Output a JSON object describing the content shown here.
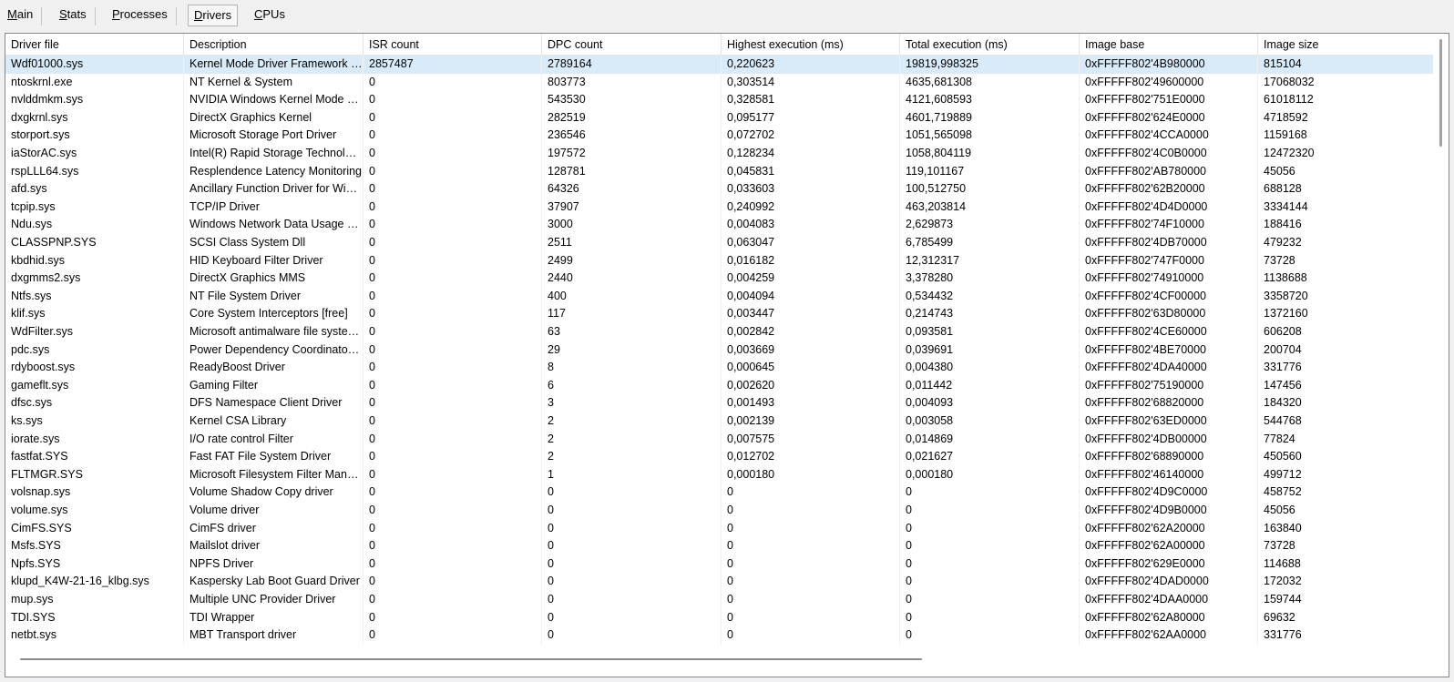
{
  "tabs": [
    {
      "label": "Main",
      "active": false
    },
    {
      "label": "Stats",
      "active": false
    },
    {
      "label": "Processes",
      "active": false
    },
    {
      "label": "Drivers",
      "active": true
    },
    {
      "label": "CPUs",
      "active": false
    }
  ],
  "columns": [
    "Driver file",
    "Description",
    "ISR count",
    "DPC count",
    "Highest execution (ms)",
    "Total execution (ms)",
    "Image base",
    "Image size"
  ],
  "rows": [
    [
      "Wdf01000.sys",
      "Kernel Mode Driver Framework Runtime",
      "2857487",
      "2789164",
      "0,220623",
      "19819,998325",
      "0xFFFFF802'4B980000",
      "815104"
    ],
    [
      "ntoskrnl.exe",
      "NT Kernel & System",
      "0",
      "803773",
      "0,303514",
      "4635,681308",
      "0xFFFFF802'49600000",
      "17068032"
    ],
    [
      "nvlddmkm.sys",
      "NVIDIA Windows Kernel Mode Driver",
      "0",
      "543530",
      "0,328581",
      "4121,608593",
      "0xFFFFF802'751E0000",
      "61018112"
    ],
    [
      "dxgkrnl.sys",
      "DirectX Graphics Kernel",
      "0",
      "282519",
      "0,095177",
      "4601,719889",
      "0xFFFFF802'624E0000",
      "4718592"
    ],
    [
      "storport.sys",
      "Microsoft Storage Port Driver",
      "0",
      "236546",
      "0,072702",
      "1051,565098",
      "0xFFFFF802'4CCA0000",
      "1159168"
    ],
    [
      "iaStorAC.sys",
      "Intel(R) Rapid Storage Technology driver",
      "0",
      "197572",
      "0,128234",
      "1058,804119",
      "0xFFFFF802'4C0B0000",
      "12472320"
    ],
    [
      "rspLLL64.sys",
      "Resplendence Latency Monitoring",
      "0",
      "128781",
      "0,045831",
      "119,101167",
      "0xFFFFF802'AB780000",
      "45056"
    ],
    [
      "afd.sys",
      "Ancillary Function Driver for WinSock",
      "0",
      "64326",
      "0,033603",
      "100,512750",
      "0xFFFFF802'62B20000",
      "688128"
    ],
    [
      "tcpip.sys",
      "TCP/IP Driver",
      "0",
      "37907",
      "0,240992",
      "463,203814",
      "0xFFFFF802'4D4D0000",
      "3334144"
    ],
    [
      "Ndu.sys",
      "Windows Network Data Usage Monitoring Driver",
      "0",
      "3000",
      "0,004083",
      "2,629873",
      "0xFFFFF802'74F10000",
      "188416"
    ],
    [
      "CLASSPNP.SYS",
      "SCSI Class System Dll",
      "0",
      "2511",
      "0,063047",
      "6,785499",
      "0xFFFFF802'4DB70000",
      "479232"
    ],
    [
      "kbdhid.sys",
      "HID Keyboard Filter Driver",
      "0",
      "2499",
      "0,016182",
      "12,312317",
      "0xFFFFF802'747F0000",
      "73728"
    ],
    [
      "dxgmms2.sys",
      "DirectX Graphics MMS",
      "0",
      "2440",
      "0,004259",
      "3,378280",
      "0xFFFFF802'74910000",
      "1138688"
    ],
    [
      "Ntfs.sys",
      "NT File System Driver",
      "0",
      "400",
      "0,004094",
      "0,534432",
      "0xFFFFF802'4CF00000",
      "3358720"
    ],
    [
      "klif.sys",
      "Core System Interceptors [free]",
      "0",
      "117",
      "0,003447",
      "0,214743",
      "0xFFFFF802'63D80000",
      "1372160"
    ],
    [
      "WdFilter.sys",
      "Microsoft antimalware file system filter driver",
      "0",
      "63",
      "0,002842",
      "0,093581",
      "0xFFFFF802'4CE60000",
      "606208"
    ],
    [
      "pdc.sys",
      "Power Dependency Coordinator Driver",
      "0",
      "29",
      "0,003669",
      "0,039691",
      "0xFFFFF802'4BE70000",
      "200704"
    ],
    [
      "rdyboost.sys",
      "ReadyBoost Driver",
      "0",
      "8",
      "0,000645",
      "0,004380",
      "0xFFFFF802'4DA40000",
      "331776"
    ],
    [
      "gameflt.sys",
      "Gaming Filter",
      "0",
      "6",
      "0,002620",
      "0,011442",
      "0xFFFFF802'75190000",
      "147456"
    ],
    [
      "dfsc.sys",
      "DFS Namespace Client Driver",
      "0",
      "3",
      "0,001493",
      "0,004093",
      "0xFFFFF802'68820000",
      "184320"
    ],
    [
      "ks.sys",
      "Kernel CSA Library",
      "0",
      "2",
      "0,002139",
      "0,003058",
      "0xFFFFF802'63ED0000",
      "544768"
    ],
    [
      "iorate.sys",
      "I/O rate control Filter",
      "0",
      "2",
      "0,007575",
      "0,014869",
      "0xFFFFF802'4DB00000",
      "77824"
    ],
    [
      "fastfat.SYS",
      "Fast FAT File System Driver",
      "0",
      "2",
      "0,012702",
      "0,021627",
      "0xFFFFF802'68890000",
      "450560"
    ],
    [
      "FLTMGR.SYS",
      "Microsoft Filesystem Filter Manager",
      "0",
      "1",
      "0,000180",
      "0,000180",
      "0xFFFFF802'46140000",
      "499712"
    ],
    [
      "volsnap.sys",
      "Volume Shadow Copy driver",
      "0",
      "0",
      "0",
      "0",
      "0xFFFFF802'4D9C0000",
      "458752"
    ],
    [
      "volume.sys",
      "Volume driver",
      "0",
      "0",
      "0",
      "0",
      "0xFFFFF802'4D9B0000",
      "45056"
    ],
    [
      "CimFS.SYS",
      "CimFS driver",
      "0",
      "0",
      "0",
      "0",
      "0xFFFFF802'62A20000",
      "163840"
    ],
    [
      "Msfs.SYS",
      "Mailslot driver",
      "0",
      "0",
      "0",
      "0",
      "0xFFFFF802'62A00000",
      "73728"
    ],
    [
      "Npfs.SYS",
      "NPFS Driver",
      "0",
      "0",
      "0",
      "0",
      "0xFFFFF802'629E0000",
      "114688"
    ],
    [
      "klupd_K4W-21-16_klbg.sys",
      "Kaspersky Lab Boot Guard Driver",
      "0",
      "0",
      "0",
      "0",
      "0xFFFFF802'4DAD0000",
      "172032"
    ],
    [
      "mup.sys",
      "Multiple UNC Provider Driver",
      "0",
      "0",
      "0",
      "0",
      "0xFFFFF802'4DAA0000",
      "159744"
    ],
    [
      "TDI.SYS",
      "TDI Wrapper",
      "0",
      "0",
      "0",
      "0",
      "0xFFFFF802'62A80000",
      "69632"
    ],
    [
      "netbt.sys",
      "MBT Transport driver",
      "0",
      "0",
      "0",
      "0",
      "0xFFFFF802'62AA0000",
      "331776"
    ]
  ],
  "selected_row": 0
}
